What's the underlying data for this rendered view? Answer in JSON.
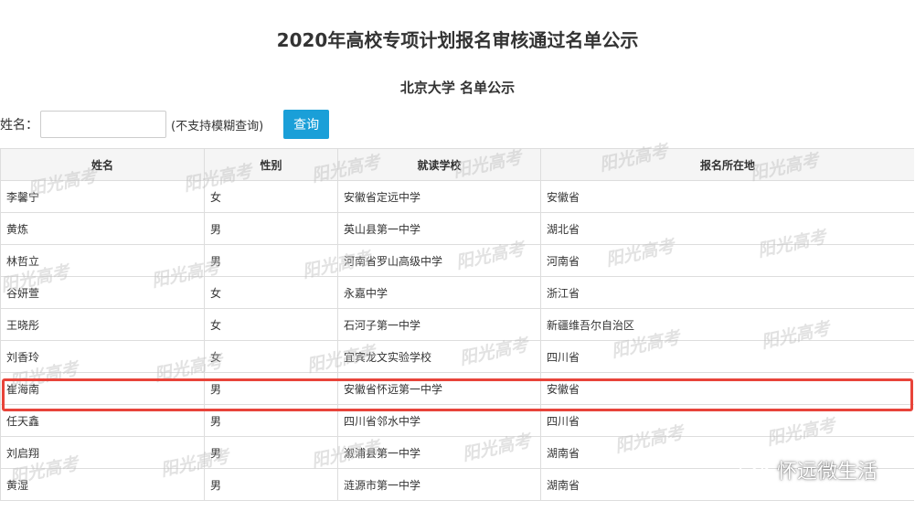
{
  "header": {
    "title": "2020年高校专项计划报名审核通过名单公示",
    "subtitle": "北京大学 名单公示"
  },
  "search": {
    "label": "姓名：",
    "placeholder": "",
    "value": "",
    "hint": "(不支持模糊查询)",
    "button_label": "查询",
    "button_color": "#1a9fd8"
  },
  "table": {
    "columns": [
      "姓名",
      "性别",
      "就读学校",
      "报名所在地"
    ],
    "rows": [
      [
        "李馨宁",
        "女",
        "安徽省定远中学",
        "安徽省"
      ],
      [
        "黄炼",
        "男",
        "英山县第一中学",
        "湖北省"
      ],
      [
        "林哲立",
        "男",
        "河南省罗山高级中学",
        "河南省"
      ],
      [
        "谷妍萱",
        "女",
        "永嘉中学",
        "浙江省"
      ],
      [
        "王晓彤",
        "女",
        "石河子第一中学",
        "新疆维吾尔自治区"
      ],
      [
        "刘香玲",
        "女",
        "宜宾龙文实验学校",
        "四川省"
      ],
      [
        "崔海南",
        "男",
        "安徽省怀远第一中学",
        "安徽省"
      ],
      [
        "任天鑫",
        "男",
        "四川省邻水中学",
        "四川省"
      ],
      [
        "刘启翔",
        "男",
        "溆浦县第一中学",
        "湖南省"
      ],
      [
        "黄湿",
        "男",
        "涟源市第一中学",
        "湖南省"
      ]
    ],
    "highlighted_row_index": 6,
    "highlight_color": "#e8443a"
  },
  "watermark": {
    "text": "阳光高考"
  },
  "account_badge": {
    "icon": "wechat-icon",
    "text": "怀远微生活"
  }
}
